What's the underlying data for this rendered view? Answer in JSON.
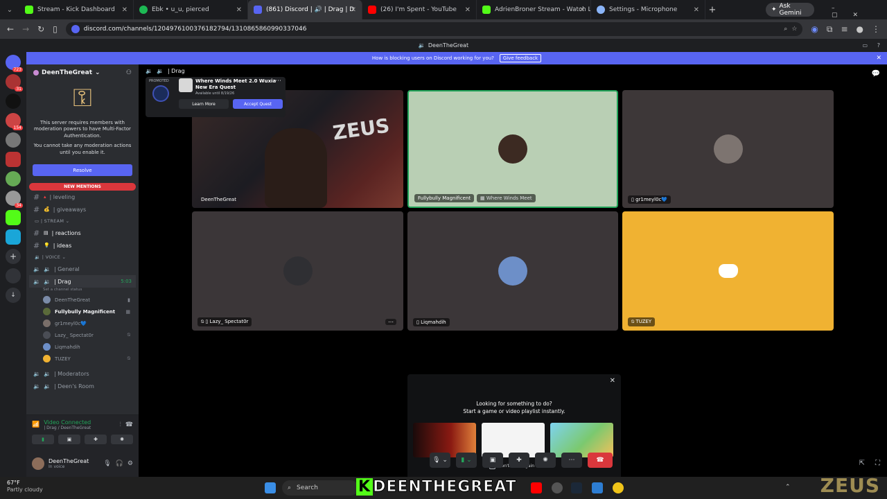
{
  "browser": {
    "tabs": [
      {
        "title": "Stream - Kick Dashboard",
        "color": "#53fc18"
      },
      {
        "title": "Ebk • u_u, pierced",
        "color": "#1db954"
      },
      {
        "title": "(861) Discord | 🔊 | Drag | D",
        "color": "#5865f2"
      },
      {
        "title": "(26) I'm Spent - YouTube",
        "color": "#ff0000"
      },
      {
        "title": "AdrienBroner Stream - Watch L",
        "color": "#53fc18"
      },
      {
        "title": "Settings - Microphone",
        "color": "#8ab4f8"
      }
    ],
    "gemini": "Ask Gemini",
    "url": "discord.com/channels/1204976100376182794/1310865860990337046"
  },
  "discord": {
    "top_title": "DeenTheGreat",
    "banner_text": "How is blocking users on Discord working for you?",
    "banner_button": "Give feedback",
    "server_badges": [
      "723",
      "31",
      "154",
      "34"
    ],
    "server_name": "DeenTheGreat",
    "mfa_text": "This server requires members with moderation powers to have Multi-Factor Authentication.",
    "mfa_text2": "You cannot take any moderation actions until you enable it.",
    "resolve_label": "Resolve",
    "new_mentions": "NEW MENTIONS",
    "channels": {
      "leveling": "| leveling",
      "giveaways": "| giveaways",
      "stream_cat": "| STREAM",
      "reactions": "| reactions",
      "ideas": "| ideas",
      "voice_cat": "VOICE",
      "general": "| General",
      "drag": "| Drag",
      "drag_time": "5:03",
      "drag_status": "Set a channel status",
      "moderators": "| Moderators",
      "deens_room": "| Deen's Room"
    },
    "voice_users": [
      "DeenTheGreat",
      "Fullybully Magnificent",
      "gr1meyl0c💙",
      "Lazy_ Spectat0r",
      "Liqmahdih",
      "TUZEY"
    ],
    "video_connected": "Video Connected",
    "video_sub": "| Drag / DeenTheGreat",
    "user_name": "DeenTheGreat",
    "user_status": "In voice",
    "call_header": "| Drag",
    "promo": {
      "tag": "PROMOTED",
      "title": "Where Winds Meet 2.0 Wuxia New Era Quest",
      "sub": "Available until 8/19/26",
      "learn": "Learn More",
      "accept": "Accept Quest"
    },
    "tiles": [
      {
        "label": "DeenTheGreat"
      },
      {
        "label": "Fullybully Magnificent",
        "activity": "Where Winds Meet"
      },
      {
        "label": "gr1meyl0c💙"
      },
      {
        "label": "Lazy_ Spectat0r"
      },
      {
        "label": "Liqmahdih"
      },
      {
        "label": "TUZEY"
      }
    ],
    "activity_q1": "Looking for something to do?",
    "activity_q2": "Start a game or video playlist instantly.",
    "dont_show": "Don't show again"
  },
  "taskbar": {
    "temp": "67°F",
    "weather": "Partly cloudy",
    "search": "Search",
    "overlay": "DEENTHEGREAT",
    "overlay_k": "K",
    "zeus": "ZEUS"
  }
}
